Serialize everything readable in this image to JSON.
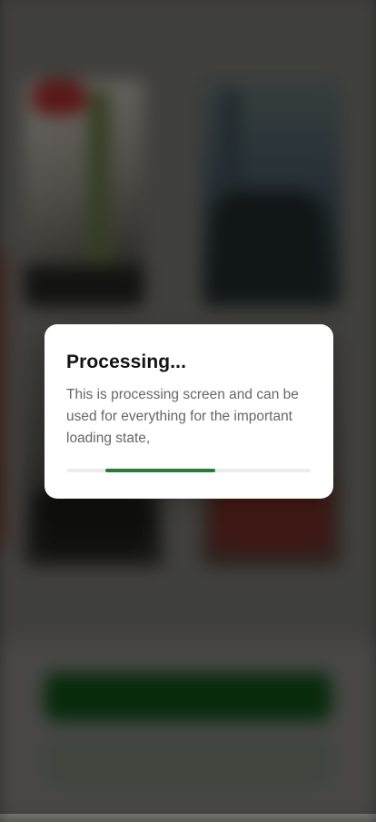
{
  "dialog": {
    "title": "Processing...",
    "message": "This is processing screen and can be used for everything for the important loading state,",
    "progress": {
      "start_fraction": 0.155,
      "end_fraction": 0.61,
      "fill_color": "#2b7a3c",
      "track_color": "#ececec"
    }
  },
  "overlay": {
    "scrim_color": "rgba(0,0,0,0.42)"
  },
  "background": {
    "primary_button_color": "#104a18",
    "secondary_button_color": "#6e776c"
  }
}
